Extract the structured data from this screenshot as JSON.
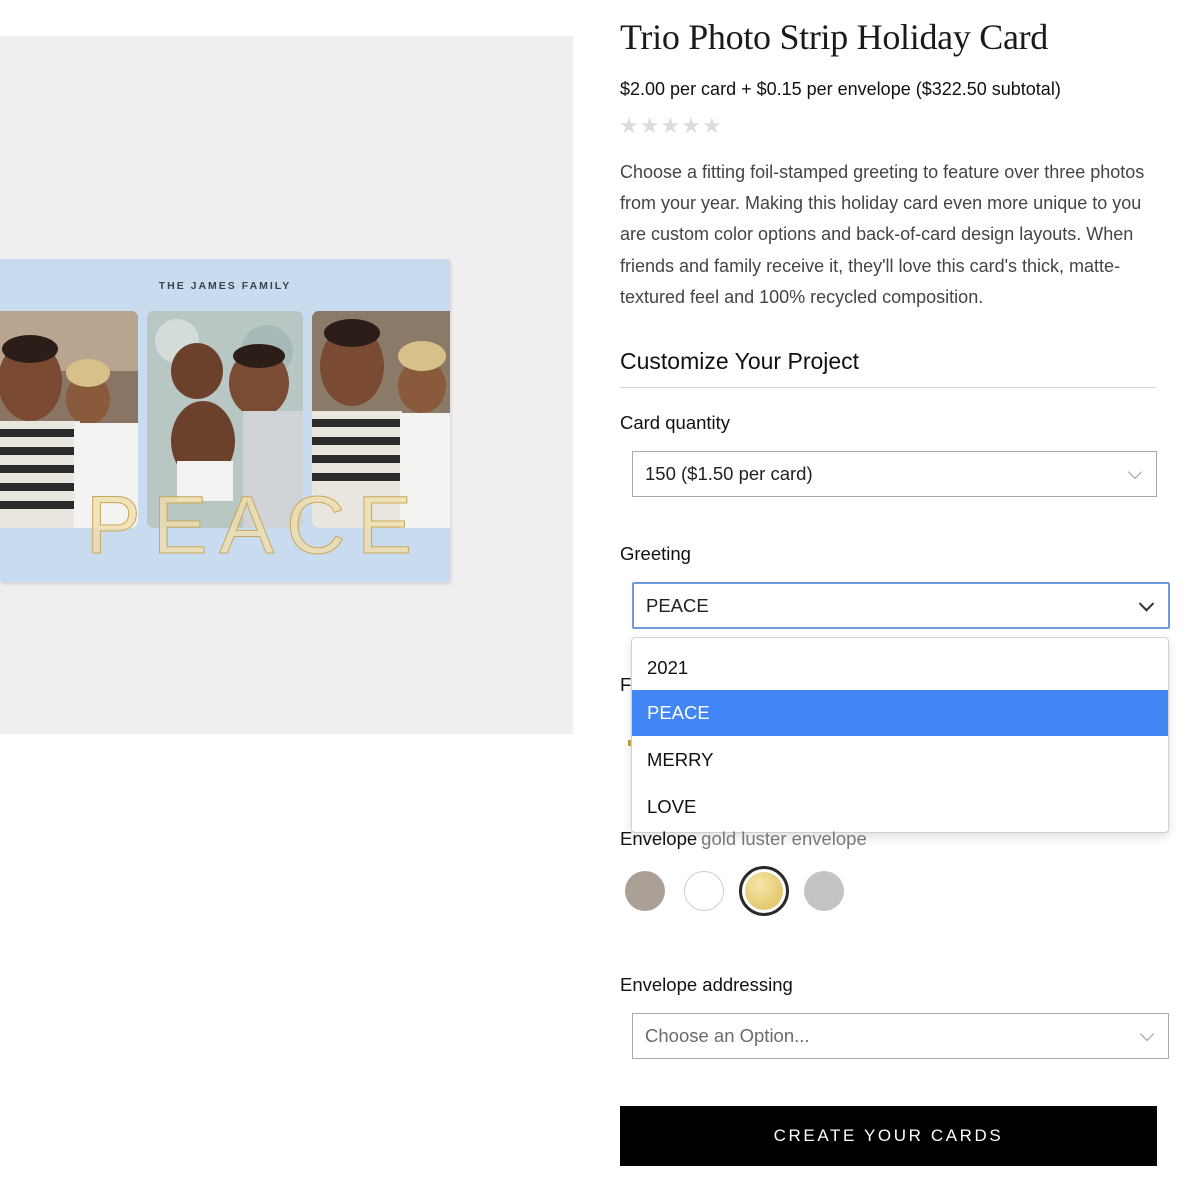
{
  "preview": {
    "family_name": "THE JAMES FAMILY",
    "greeting_foil": "PEACE"
  },
  "product": {
    "title": "Trio Photo Strip Holiday Card",
    "price_line": "$2.00 per card + $0.15 per envelope ($322.50 subtotal)",
    "rating_stars": [
      "★",
      "★",
      "★",
      "★",
      "★"
    ],
    "rating_value": 0,
    "rating_max": 5,
    "description": "Choose a fitting foil-stamped greeting to feature over three photos from your year. Making this holiday card even more unique to you are custom color options and back-of-card design layouts. When friends and family receive it, they'll love this card's thick, matte-textured feel and 100% recycled composition."
  },
  "customize": {
    "section_title": "Customize Your Project",
    "quantity": {
      "label": "Card quantity",
      "value": "150 ($1.50 per card)"
    },
    "greeting": {
      "label": "Greeting",
      "value": "PEACE",
      "options": [
        "2021",
        "PEACE",
        "MERRY",
        "LOVE"
      ],
      "selected_index": 1
    },
    "obscured_label_fragment": "F",
    "envelope": {
      "label": "Envelope",
      "selected_name": "gold luster envelope",
      "swatches": [
        {
          "name": "taupe",
          "color": "#aaa095"
        },
        {
          "name": "white",
          "color": "#ffffff"
        },
        {
          "name": "gold luster",
          "color": "#e2c56a",
          "selected": true
        },
        {
          "name": "silver",
          "color": "#c4c3c5"
        }
      ]
    },
    "addressing": {
      "label": "Envelope addressing",
      "placeholder": "Choose an Option..."
    }
  },
  "cta": {
    "label": "CREATE YOUR CARDS"
  },
  "colors": {
    "highlight": "#4285f4",
    "focus_border": "#6f9ad8",
    "cta_bg": "#000000",
    "card_bg": "#c9dcef",
    "foil": "#c9a85a"
  }
}
